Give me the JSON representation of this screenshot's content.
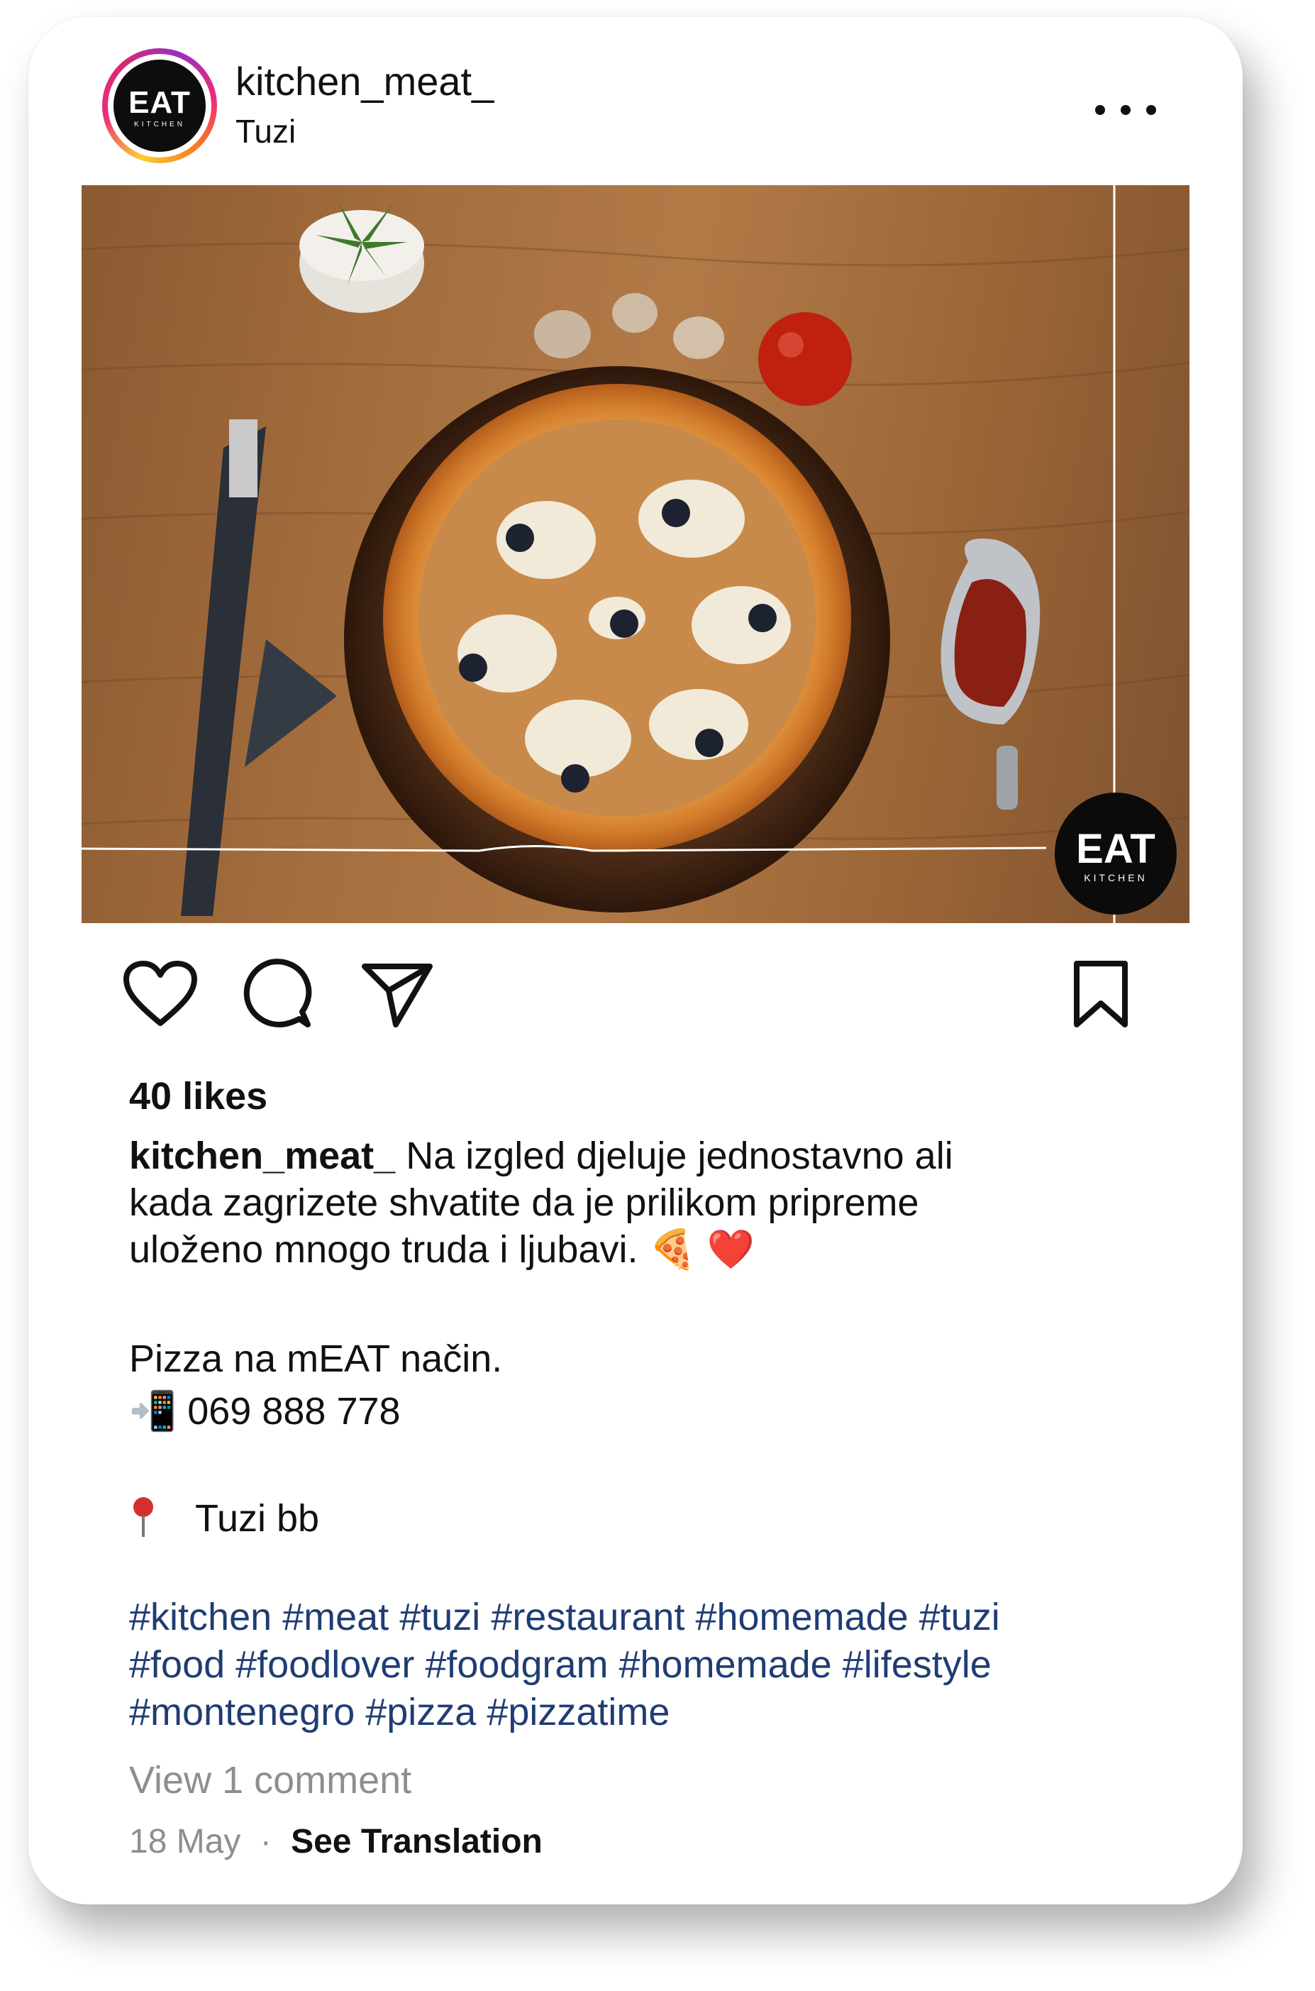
{
  "post": {
    "username": "kitchen_meat_",
    "location": "Tuzi",
    "avatar_logo_main": "EAT",
    "avatar_logo_sub": "KITCHEN",
    "more_icon": "more-horizontal-icon"
  },
  "image": {
    "description_badge_main": "EAT",
    "description_badge_sub": "KITCHEN"
  },
  "actions": {
    "like_icon": "heart-icon",
    "comment_icon": "comment-icon",
    "share_icon": "send-icon",
    "save_icon": "bookmark-icon"
  },
  "likes": "40 likes",
  "caption": {
    "user": "kitchen_meat_",
    "line1_text": "Na izgled djeluje jednostavno ali",
    "line2": "kada zagrizete shvatite da je prilikom pripreme",
    "line3": "uloženo mnogo truda i ljubavi. 🍕 ❤️",
    "line4": "Pizza na mEAT način.",
    "line5": "📲 069 888 778",
    "line6": "Tuzi bb"
  },
  "hashtags": {
    "row1": "#kitchen #meat #tuzi #restaurant #homemade #tuzi",
    "row2": "#food #foodlover #foodgram #homemade #lifestyle",
    "row3": "#montenegro #pizza #pizzatime"
  },
  "view_comments": "View 1 comment",
  "date": "18 May",
  "separator": "·",
  "see_translation": "See Translation",
  "colors": {
    "hashtag": "#1f3d73",
    "muted": "#8e8e8e",
    "text": "#111111"
  }
}
